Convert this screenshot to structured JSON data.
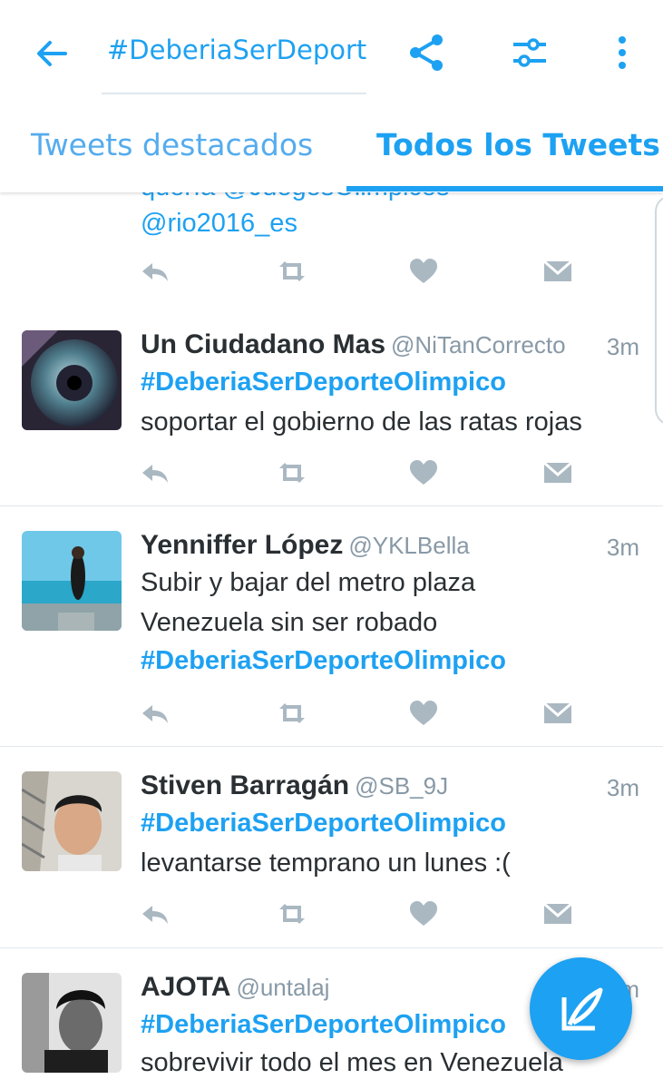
{
  "toolbar": {
    "search_query": "#DeberiaSerDeporteOlimpico",
    "back_icon": "arrow-left-icon",
    "share_icon": "share-icon",
    "filter_icon": "filter-sliders-icon",
    "more_icon": "more-vert-icon"
  },
  "tabs": [
    {
      "label": "Tweets destacados",
      "active": false
    },
    {
      "label": "Todos los Tweets",
      "active": true
    }
  ],
  "partial_tweet": {
    "line_cut": "quería @JuegosOlimpicos",
    "line": "@rio2016_es"
  },
  "tweets": [
    {
      "name": "Un Ciudadano Mas",
      "handle": "@NiTanCorrecto",
      "time": "3m",
      "lines": [
        "#DeberiaSerDeporteOlimpico",
        "soportar el gobierno de las ratas rojas"
      ]
    },
    {
      "name": "Yenniffer López",
      "handle": "@YKLBella",
      "time": "3m",
      "lines": [
        "Subir y bajar del metro plaza",
        "Venezuela sin ser robado",
        "#DeberiaSerDeporteOlimpico"
      ]
    },
    {
      "name": "Stiven Barragán",
      "handle": "@SB_9J",
      "time": "3m",
      "lines": [
        "#DeberiaSerDeporteOlimpico",
        "levantarse temprano un lunes :("
      ]
    },
    {
      "name": "AJOTA",
      "handle": "@untalaj",
      "time": "3m",
      "lines": [
        "#DeberiaSerDeporteOlimpico",
        "sobrevivir todo el mes en Venezuela"
      ]
    }
  ],
  "colors": {
    "accent": "#1da1f2",
    "text": "#292f33",
    "muted": "#8899a6",
    "action": "#aab8c2"
  },
  "fab_icon": "compose-tweet-icon"
}
